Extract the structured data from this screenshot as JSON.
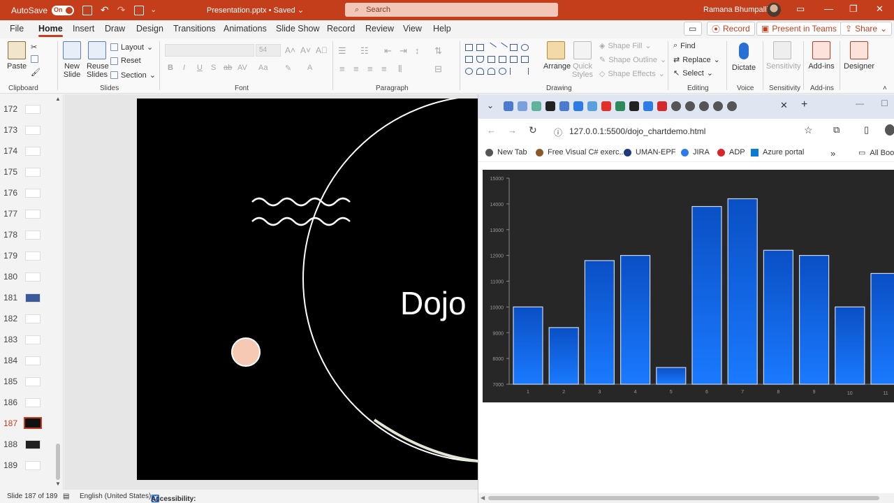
{
  "titlebar": {
    "autosave_label": "AutoSave",
    "autosave_state": "On",
    "document_title": "Presentation.pptx • Saved ⌄",
    "search_placeholder": "Search",
    "user_name": "Ramana Bhumpalli",
    "accent_color": "#c43e1c"
  },
  "tabs": [
    "File",
    "Home",
    "Insert",
    "Draw",
    "Design",
    "Transitions",
    "Animations",
    "Slide Show",
    "Record",
    "Review",
    "View",
    "Help"
  ],
  "active_tab": "Home",
  "header_actions": {
    "record": "Record",
    "present_in_teams": "Present in Teams",
    "share": "Share"
  },
  "ribbon": {
    "clipboard": {
      "paste": "Paste",
      "label": "Clipboard"
    },
    "slides": {
      "new_slide": "New Slide",
      "reuse_slides": "Reuse Slides",
      "layout": "Layout",
      "reset": "Reset",
      "section": "Section",
      "label": "Slides"
    },
    "font": {
      "size": "54",
      "label": "Font"
    },
    "paragraph": {
      "label": "Paragraph"
    },
    "drawing": {
      "arrange": "Arrange",
      "quick_styles": "Quick Styles",
      "shape_fill": "Shape Fill",
      "shape_outline": "Shape Outline",
      "shape_effects": "Shape Effects",
      "label": "Drawing"
    },
    "editing": {
      "find": "Find",
      "replace": "Replace",
      "select": "Select",
      "label": "Editing"
    },
    "voice": {
      "dictate": "Dictate",
      "label": "Voice"
    },
    "sensitivity": {
      "button": "Sensitivity",
      "label": "Sensitivity"
    },
    "addins": {
      "button": "Add-ins",
      "label": "Add-ins"
    },
    "designer": {
      "button": "Designer"
    }
  },
  "thumbnails": [
    {
      "num": "172",
      "style": "light"
    },
    {
      "num": "173",
      "style": "light"
    },
    {
      "num": "174",
      "style": "light"
    },
    {
      "num": "175",
      "style": "light"
    },
    {
      "num": "176",
      "style": "light"
    },
    {
      "num": "177",
      "style": "light"
    },
    {
      "num": "178",
      "style": "light"
    },
    {
      "num": "179",
      "style": "light"
    },
    {
      "num": "180",
      "style": "light"
    },
    {
      "num": "181",
      "style": "blue"
    },
    {
      "num": "182",
      "style": "light"
    },
    {
      "num": "183",
      "style": "light"
    },
    {
      "num": "184",
      "style": "light"
    },
    {
      "num": "185",
      "style": "light"
    },
    {
      "num": "186",
      "style": "light"
    },
    {
      "num": "187",
      "style": "selected"
    },
    {
      "num": "188",
      "style": "dark"
    },
    {
      "num": "189",
      "style": "light"
    }
  ],
  "slide": {
    "title": "Dojo"
  },
  "browser": {
    "url": "127.0.0.1:5500/dojo_chartdemo.html",
    "bookmarks": [
      "New Tab",
      "Free Visual C# exerc...",
      "UMAN-EPF",
      "JIRA",
      "ADP",
      "Azure portal"
    ],
    "all_bookmarks": "All Boo"
  },
  "chart_data": {
    "type": "bar",
    "categories": [
      "1",
      "2",
      "3",
      "4",
      "5",
      "6",
      "7",
      "8",
      "9",
      "10",
      "11"
    ],
    "values": [
      10000,
      9200,
      11800,
      12000,
      7650,
      13900,
      14200,
      12200,
      12000,
      10000,
      11300
    ],
    "ylim": [
      7000,
      15000
    ],
    "yticks": [
      7000,
      8000,
      9000,
      10000,
      11000,
      12000,
      13000,
      14000,
      15000
    ],
    "bar_color": "#1a66ff",
    "background": "#272727"
  },
  "statusbar": {
    "slide_info": "Slide 187 of 189",
    "language": "English (United States)",
    "accessibility": "Accessibility: Investigate"
  }
}
